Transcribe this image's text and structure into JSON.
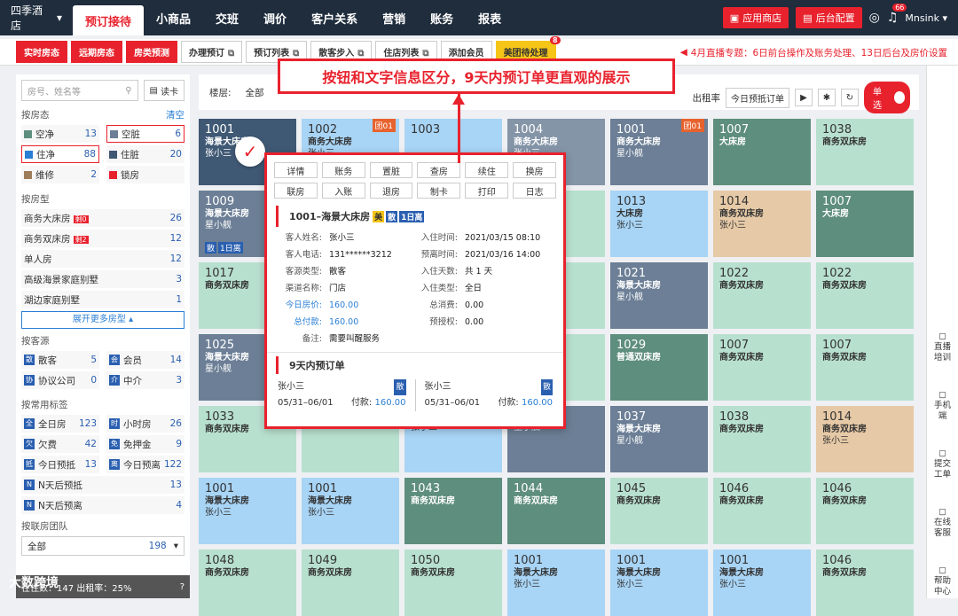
{
  "app": {
    "hotel": "四季酒店",
    "user": "Mnsink",
    "notify_count": "66"
  },
  "nav": [
    "预订接待",
    "小商品",
    "交班",
    "调价",
    "客户关系",
    "营销",
    "账务",
    "报表"
  ],
  "topbtns": {
    "app_store": "应用商店",
    "backend": "后台配置"
  },
  "subtabs": [
    "实时房态",
    "远期房态",
    "房类预测",
    "办理预订",
    "预订列表",
    "散客步入",
    "住店列表",
    "添加会员",
    "美团待处理"
  ],
  "subtab_badge": "8",
  "notice": "4月直播专题：6日前台操作及账务处理、13日后台及房价设置",
  "banner": "按钮和文字信息区分，9天内预订单更直观的展示",
  "sidebar": {
    "search_placeholder": "房号、姓名等",
    "card": "读卡",
    "status_title": "按房态",
    "clear": "清空",
    "status": [
      {
        "label": "空净",
        "num": "13",
        "color": "#5e8e7d"
      },
      {
        "label": "空脏",
        "num": "6",
        "color": "#6c7f96"
      },
      {
        "label": "住净",
        "num": "88",
        "color": "#2a7fd5"
      },
      {
        "label": "住脏",
        "num": "20",
        "color": "#3f5874"
      },
      {
        "label": "维修",
        "num": "2",
        "color": "#9e7e5a"
      },
      {
        "label": "锁房",
        "num": "",
        "color": "#e8222d"
      }
    ],
    "type_title": "按房型",
    "types": [
      {
        "label": "商务大床房",
        "tag": "剩0",
        "num": "26"
      },
      {
        "label": "商务双床房",
        "tag": "剩2",
        "num": "12"
      },
      {
        "label": "单人房",
        "tag": "",
        "num": "12"
      },
      {
        "label": "高级海景家庭别墅",
        "tag": "",
        "num": "3"
      },
      {
        "label": "湖边家庭别墅",
        "tag": "",
        "num": "1"
      }
    ],
    "expand": "展开更多房型",
    "source_title": "按客源",
    "sources": [
      {
        "k": "散",
        "label": "散客",
        "num": "5"
      },
      {
        "k": "会",
        "label": "会员",
        "num": "14"
      },
      {
        "k": "协",
        "label": "协议公司",
        "num": "0"
      },
      {
        "k": "介",
        "label": "中介",
        "num": "3"
      }
    ],
    "tags_title": "按常用标签",
    "tags": [
      {
        "k": "全",
        "label": "全日房",
        "num": "123"
      },
      {
        "k": "时",
        "label": "小时房",
        "num": "26"
      },
      {
        "k": "欠",
        "label": "欠费",
        "num": "42"
      },
      {
        "k": "免",
        "label": "免押金",
        "num": "9"
      },
      {
        "k": "抵",
        "label": "今日预抵",
        "num": "13"
      },
      {
        "k": "离",
        "label": "今日预离",
        "num": "122"
      }
    ],
    "tags_single": [
      {
        "k": "N",
        "label": "N天后预抵",
        "num": "13"
      },
      {
        "k": "N",
        "label": "N天后预离",
        "num": "4"
      }
    ],
    "group_title": "按联房团队",
    "group_sel": "全部",
    "group_num": "198",
    "bottom_text": "在住数：147  出租率：25%"
  },
  "toolbar": {
    "floor_label": "楼层:",
    "floor_sel": "全部",
    "occ": "出租率",
    "today": "今日预抵订单",
    "single": "单选"
  },
  "rooms": [
    {
      "no": "1001",
      "type": "海景大床房",
      "guest": "张小三",
      "c": "c-dark"
    },
    {
      "no": "1002",
      "type": "商务大床房",
      "guest": "张小三",
      "c": "c-light",
      "grp": "团01"
    },
    {
      "no": "1003",
      "type": "",
      "guest": "",
      "c": "c-light"
    },
    {
      "no": "1004",
      "type": "商务大床房",
      "guest": "张小三",
      "c": "c-gray"
    },
    {
      "no": "1001",
      "type": "商务大床房",
      "guest": "星小舰",
      "c": "c-slate",
      "grp": "团01"
    },
    {
      "no": "1007",
      "type": "大床房",
      "guest": "",
      "c": "c-green"
    },
    {
      "no": "1038",
      "type": "商务双床房",
      "guest": "",
      "c": "c-mint"
    },
    {
      "no": "1009",
      "type": "海景大床房",
      "guest": "星小舰",
      "c": "c-slate",
      "stags": [
        "散",
        "1日离"
      ]
    },
    {
      "no": "",
      "type": "",
      "guest": "",
      "c": "c-mint"
    },
    {
      "no": "",
      "type": "",
      "guest": "",
      "c": "c-mint"
    },
    {
      "no": "",
      "type": "",
      "guest": "",
      "c": "c-mint"
    },
    {
      "no": "1013",
      "type": "大床房",
      "guest": "张小三",
      "c": "c-light"
    },
    {
      "no": "1014",
      "type": "商务双床房",
      "guest": "张小三",
      "c": "c-tan"
    },
    {
      "no": "1007",
      "type": "大床房",
      "guest": "",
      "c": "c-green"
    },
    {
      "no": "1017",
      "type": "商务双床房",
      "guest": "",
      "c": "c-mint"
    },
    {
      "no": "",
      "type": "",
      "guest": "",
      "c": "c-mint"
    },
    {
      "no": "",
      "type": "",
      "guest": "",
      "c": "c-mint"
    },
    {
      "no": "",
      "type": "",
      "guest": "",
      "c": "c-mint"
    },
    {
      "no": "1021",
      "type": "海景大床房",
      "guest": "星小舰",
      "c": "c-slate"
    },
    {
      "no": "1022",
      "type": "商务双床房",
      "guest": "",
      "c": "c-mint"
    },
    {
      "no": "1022",
      "type": "商务双床房",
      "guest": "",
      "c": "c-mint"
    },
    {
      "no": "1025",
      "type": "海景大床房",
      "guest": "星小舰",
      "c": "c-slate"
    },
    {
      "no": "",
      "type": "",
      "guest": "",
      "c": "c-mint"
    },
    {
      "no": "",
      "type": "",
      "guest": "",
      "c": "c-mint"
    },
    {
      "no": "",
      "type": "",
      "guest": "",
      "c": "c-mint"
    },
    {
      "no": "1029",
      "type": "普通双床房",
      "guest": "",
      "c": "c-green"
    },
    {
      "no": "1007",
      "type": "商务双床房",
      "guest": "",
      "c": "c-mint"
    },
    {
      "no": "1007",
      "type": "商务双床房",
      "guest": "",
      "c": "c-mint"
    },
    {
      "no": "1033",
      "type": "商务双床房",
      "guest": "",
      "c": "c-mint"
    },
    {
      "no": "",
      "type": "",
      "guest": "",
      "c": "c-mint"
    },
    {
      "no": "",
      "type": "海景大床房",
      "guest": "张小三",
      "c": "c-light"
    },
    {
      "no": "",
      "type": "海景大床房",
      "guest": "星小舰",
      "c": "c-slate"
    },
    {
      "no": "1037",
      "type": "海景大床房",
      "guest": "星小舰",
      "c": "c-slate"
    },
    {
      "no": "1038",
      "type": "商务双床房",
      "guest": "",
      "c": "c-mint"
    },
    {
      "no": "1014",
      "type": "商务双床房",
      "guest": "张小三",
      "c": "c-tan"
    },
    {
      "no": "1001",
      "type": "海景大床房",
      "guest": "张小三",
      "c": "c-light"
    },
    {
      "no": "1001",
      "type": "海景大床房",
      "guest": "张小三",
      "c": "c-light"
    },
    {
      "no": "1043",
      "type": "商务双床房",
      "guest": "",
      "c": "c-green"
    },
    {
      "no": "1044",
      "type": "商务双床房",
      "guest": "",
      "c": "c-green"
    },
    {
      "no": "1045",
      "type": "商务双床房",
      "guest": "",
      "c": "c-mint"
    },
    {
      "no": "1046",
      "type": "商务双床房",
      "guest": "",
      "c": "c-mint"
    },
    {
      "no": "1046",
      "type": "商务双床房",
      "guest": "",
      "c": "c-mint"
    },
    {
      "no": "1048",
      "type": "商务双床房",
      "guest": "",
      "c": "c-mint"
    },
    {
      "no": "1049",
      "type": "商务双床房",
      "guest": "",
      "c": "c-mint"
    },
    {
      "no": "1050",
      "type": "商务双床房",
      "guest": "",
      "c": "c-mint"
    },
    {
      "no": "1001",
      "type": "海景大床房",
      "guest": "张小三",
      "c": "c-light"
    },
    {
      "no": "1001",
      "type": "海景大床房",
      "guest": "张小三",
      "c": "c-light"
    },
    {
      "no": "1001",
      "type": "海景大床房",
      "guest": "张小三",
      "c": "c-light"
    },
    {
      "no": "1046",
      "type": "商务双床房",
      "guest": "",
      "c": "c-mint"
    }
  ],
  "popup": {
    "btns": [
      "详情",
      "账务",
      "置脏",
      "查房",
      "续住",
      "换房",
      "联房",
      "入账",
      "退房",
      "制卡",
      "打印",
      "日志"
    ],
    "title": "1001–海景大床房",
    "tags": [
      "美",
      "散",
      "1日离"
    ],
    "fields": [
      {
        "k": "客人姓名:",
        "v": "张小三"
      },
      {
        "k": "入住时间:",
        "v": "2021/03/15 08:10"
      },
      {
        "k": "客人电话:",
        "v": "131******3212"
      },
      {
        "k": "预离时间:",
        "v": "2021/03/16 14:00"
      },
      {
        "k": "客源类型:",
        "v": "散客"
      },
      {
        "k": "入住天数:",
        "v": "共 1 天"
      },
      {
        "k": "渠道名称:",
        "v": "门店"
      },
      {
        "k": "入住类型:",
        "v": "全日"
      },
      {
        "k": "今日房价:",
        "v": "160.00",
        "blue": true
      },
      {
        "k": "总消费:",
        "v": "0.00"
      },
      {
        "k": "总付款:",
        "v": "160.00",
        "blue": true
      },
      {
        "k": "预授权:",
        "v": "0.00"
      },
      {
        "k": "备注:",
        "v": "需要叫醒服务"
      }
    ],
    "resv_title": "9天内预订单",
    "resv": [
      {
        "name": "张小三",
        "badge": "散",
        "date": "05/31–06/01",
        "pay_label": "付款:",
        "pay": "160.00"
      },
      {
        "name": "张小三",
        "badge": "散",
        "date": "05/31–06/01",
        "pay_label": "付款:",
        "pay": "160.00"
      }
    ]
  },
  "rightbar": [
    {
      "label": "直播培训",
      "icon": "live-icon"
    },
    {
      "label": "手机端",
      "icon": "phone-icon"
    },
    {
      "label": "提交工单",
      "icon": "ticket-icon"
    },
    {
      "label": "在线客服",
      "icon": "chat-icon"
    },
    {
      "label": "帮助中心",
      "icon": "help-icon"
    }
  ],
  "watermark": "大数跨境"
}
